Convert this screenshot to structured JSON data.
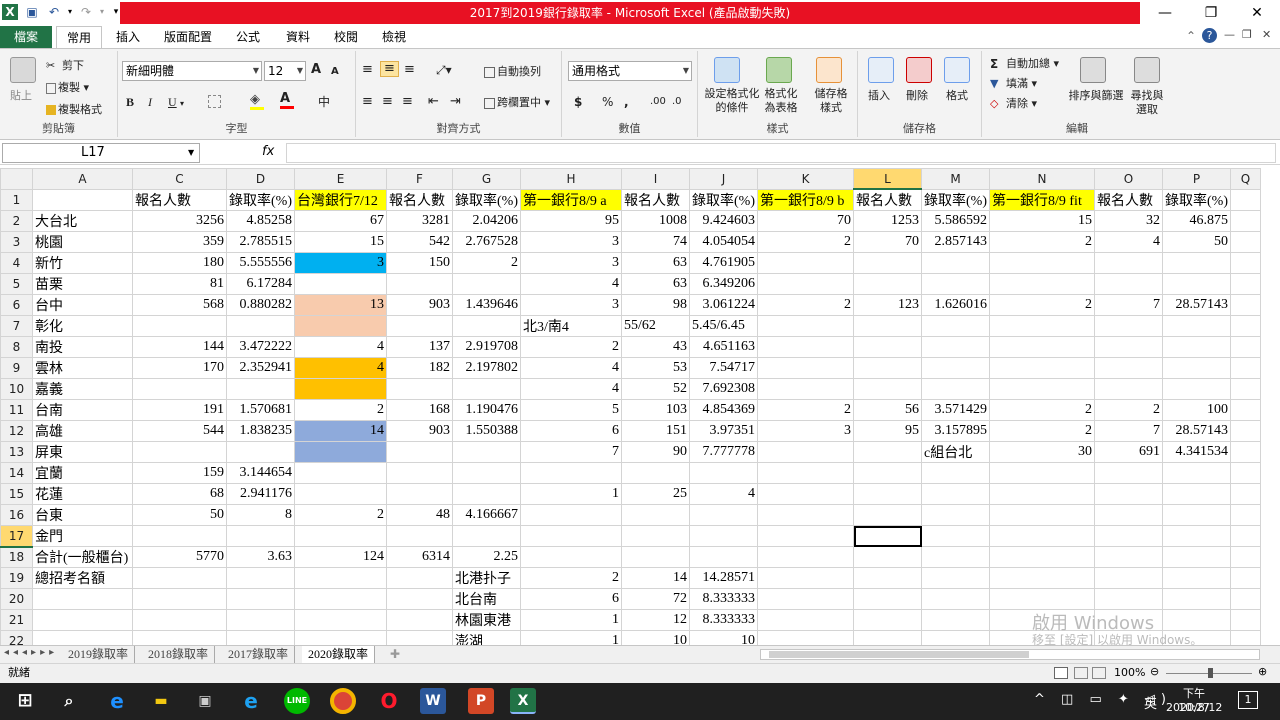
{
  "window": {
    "title": "2017到2019銀行錄取率 - Microsoft Excel (產品啟動失敗)",
    "controls": {
      "minimize": "—",
      "restore": "❐",
      "close": "✕"
    }
  },
  "ribbon_tabs": [
    "檔案",
    "常用",
    "插入",
    "版面配置",
    "公式",
    "資料",
    "校閱",
    "檢視"
  ],
  "active_tab": "常用",
  "clipboard": {
    "paste": "貼上",
    "cut": "剪下",
    "copy": "複製",
    "format_painter": "複製格式",
    "label": "剪貼簿"
  },
  "font": {
    "name": "新細明體",
    "size": "12",
    "label": "字型",
    "grow": "A",
    "shrink": "A",
    "bold": "B",
    "italic": "I",
    "underline": "U"
  },
  "alignment": {
    "wrap": "自動換列",
    "merge": "跨欄置中",
    "label": "對齊方式"
  },
  "number": {
    "format": "通用格式",
    "currency": "$",
    "percent": "%",
    "comma": ",",
    "label": "數值"
  },
  "styles": {
    "conditional": "設定格式化的條件",
    "table": "格式化為表格",
    "cell": "儲存格樣式",
    "label": "樣式"
  },
  "cells": {
    "insert": "插入",
    "delete": "刪除",
    "format": "格式",
    "label": "儲存格"
  },
  "editing": {
    "autosum": "自動加總",
    "fill": "填滿",
    "clear": "清除",
    "sort": "排序與篩選",
    "find": "尋找與選取",
    "label": "編輯"
  },
  "formula_bar": {
    "name_box": "L17",
    "fx": "fx",
    "value": ""
  },
  "columns": [
    "A",
    "C",
    "D",
    "E",
    "F",
    "G",
    "H",
    "I",
    "J",
    "K",
    "L",
    "M",
    "N",
    "O",
    "P",
    "Q"
  ],
  "selected_column": "L",
  "selected_row": 17,
  "rows": [
    {
      "r": 1,
      "c": [
        "",
        "報名人數",
        "錄取率(%)",
        "台灣銀行7/12",
        "報名人數",
        "錄取率(%)",
        "第一銀行8/9 a",
        "報名人數",
        "錄取率(%)",
        "第一銀行8/9 b",
        "報名人數",
        "錄取率(%)",
        "第一銀行8/9 fit",
        "報名人數",
        "錄取率(%)",
        ""
      ]
    },
    {
      "r": 2,
      "c": [
        "大台北",
        "3256",
        "4.85258",
        "67",
        "3281",
        "2.04206",
        "95",
        "1008",
        "9.424603",
        "70",
        "1253",
        "5.586592",
        "15",
        "32",
        "46.875",
        ""
      ]
    },
    {
      "r": 3,
      "c": [
        "桃園",
        "359",
        "2.785515",
        "15",
        "542",
        "2.767528",
        "3",
        "74",
        "4.054054",
        "2",
        "70",
        "2.857143",
        "2",
        "4",
        "50",
        ""
      ]
    },
    {
      "r": 4,
      "c": [
        "新竹",
        "180",
        "5.555556",
        "3",
        "150",
        "2",
        "3",
        "63",
        "4.761905",
        "",
        "",
        "",
        "",
        "",
        "",
        ""
      ]
    },
    {
      "r": 5,
      "c": [
        "苗栗",
        "81",
        "6.17284",
        "",
        "",
        "",
        "4",
        "63",
        "6.349206",
        "",
        "",
        "",
        "",
        "",
        "",
        ""
      ]
    },
    {
      "r": 6,
      "c": [
        "台中",
        "568",
        "0.880282",
        "13",
        "903",
        "1.439646",
        "3",
        "98",
        "3.061224",
        "2",
        "123",
        "1.626016",
        "2",
        "7",
        "28.57143",
        ""
      ]
    },
    {
      "r": 7,
      "c": [
        "彰化",
        "",
        "",
        "",
        "",
        "",
        "北3/南4",
        "55/62",
        "5.45/6.45",
        "",
        "",
        "",
        "",
        "",
        "",
        ""
      ]
    },
    {
      "r": 8,
      "c": [
        "南投",
        "144",
        "3.472222",
        "4",
        "137",
        "2.919708",
        "2",
        "43",
        "4.651163",
        "",
        "",
        "",
        "",
        "",
        "",
        ""
      ]
    },
    {
      "r": 9,
      "c": [
        "雲林",
        "170",
        "2.352941",
        "4",
        "182",
        "2.197802",
        "4",
        "53",
        "7.54717",
        "",
        "",
        "",
        "",
        "",
        "",
        ""
      ]
    },
    {
      "r": 10,
      "c": [
        "嘉義",
        "",
        "",
        "",
        "",
        "",
        "4",
        "52",
        "7.692308",
        "",
        "",
        "",
        "",
        "",
        "",
        ""
      ]
    },
    {
      "r": 11,
      "c": [
        "台南",
        "191",
        "1.570681",
        "2",
        "168",
        "1.190476",
        "5",
        "103",
        "4.854369",
        "2",
        "56",
        "3.571429",
        "2",
        "2",
        "100",
        ""
      ]
    },
    {
      "r": 12,
      "c": [
        "高雄",
        "544",
        "1.838235",
        "14",
        "903",
        "1.550388",
        "6",
        "151",
        "3.97351",
        "3",
        "95",
        "3.157895",
        "2",
        "7",
        "28.57143",
        ""
      ]
    },
    {
      "r": 13,
      "c": [
        "屏東",
        "",
        "",
        "",
        "",
        "",
        "7",
        "90",
        "7.777778",
        "",
        "",
        "c組台北",
        "30",
        "691",
        "4.341534",
        ""
      ]
    },
    {
      "r": 14,
      "c": [
        "宜蘭",
        "159",
        "3.144654",
        "",
        "",
        "",
        "",
        "",
        "",
        "",
        "",
        "",
        "",
        "",
        "",
        ""
      ]
    },
    {
      "r": 15,
      "c": [
        "花蓮",
        "68",
        "2.941176",
        "",
        "",
        "",
        "1",
        "25",
        "4",
        "",
        "",
        "",
        "",
        "",
        "",
        ""
      ]
    },
    {
      "r": 16,
      "c": [
        "台東",
        "50",
        "8",
        "2",
        "48",
        "4.166667",
        "",
        "",
        "",
        "",
        "",
        "",
        "",
        "",
        "",
        ""
      ]
    },
    {
      "r": 17,
      "c": [
        "金門",
        "",
        "",
        "",
        "",
        "",
        "",
        "",
        "",
        "",
        "",
        "",
        "",
        "",
        "",
        ""
      ]
    },
    {
      "r": 18,
      "c": [
        "合計(一般櫃台)",
        "5770",
        "3.63",
        "124",
        "6314",
        "2.25",
        "",
        "",
        "",
        "",
        "",
        "",
        "",
        "",
        "",
        ""
      ]
    },
    {
      "r": 19,
      "c": [
        "總招考名額",
        "",
        "",
        "",
        "",
        "北港扑子",
        "2",
        "14",
        "14.28571",
        "",
        "",
        "",
        "",
        "",
        "",
        ""
      ]
    },
    {
      "r": 20,
      "c": [
        "",
        "",
        "",
        "",
        "",
        "北台南",
        "6",
        "72",
        "8.333333",
        "",
        "",
        "",
        "",
        "",
        "",
        ""
      ]
    },
    {
      "r": 21,
      "c": [
        "",
        "",
        "",
        "",
        "",
        "林園東港",
        "1",
        "12",
        "8.333333",
        "",
        "",
        "",
        "",
        "",
        "",
        ""
      ]
    },
    {
      "r": 22,
      "c": [
        "",
        "",
        "",
        "",
        "",
        "澎湖",
        "1",
        "10",
        "10",
        "",
        "",
        "",
        "",
        "",
        "",
        ""
      ]
    }
  ],
  "sheet_tabs": [
    "2019錄取率",
    "2018錄取率",
    "2017錄取率",
    "2020錄取率"
  ],
  "active_sheet": "2020錄取率",
  "status": {
    "ready": "就緒",
    "zoom": "100%"
  },
  "watermark": {
    "line1": "啟用 Windows",
    "line2": "移至 [設定] 以啟用 Windows。"
  },
  "taskbar": {
    "time": "下午 10:27",
    "date": "2020/8/12",
    "ime": "英",
    "notification_count": "1"
  },
  "colors": {
    "yellow": "#ffff00",
    "cyan": "#00b0f0",
    "peach": "#f8cbad",
    "orange": "#ffc000",
    "steel_blue": "#8eaadb",
    "excel_green": "#217346",
    "title_red": "#e81123"
  }
}
